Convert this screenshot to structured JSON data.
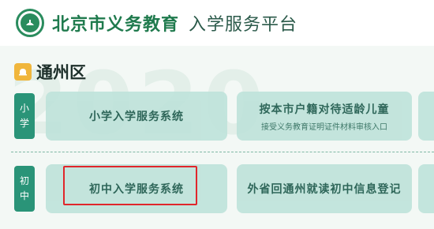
{
  "header": {
    "title_main": "北京市义务教育",
    "title_sub": "入学服务平台"
  },
  "watermark": "2020",
  "district": {
    "label": "通州区"
  },
  "sections": {
    "primary_tag": [
      "小",
      "学"
    ],
    "middle_tag": [
      "初",
      "中"
    ]
  },
  "cards": {
    "primary_system": "小学入学服务系统",
    "age_appropriate_title": "按本市户籍对待适龄儿童",
    "age_appropriate_subtitle": "接受义务教育证明证件材料审核入口",
    "middle_system": "初中入学服务系统",
    "outside_registration": "外省回通州就读初中信息登记"
  },
  "colors": {
    "brand_green": "#1f7a4d",
    "tag_green": "#2a9478",
    "card_bg": "#bfe3da",
    "highlight_red": "#e0262b",
    "district_icon": "#f0b63c"
  }
}
